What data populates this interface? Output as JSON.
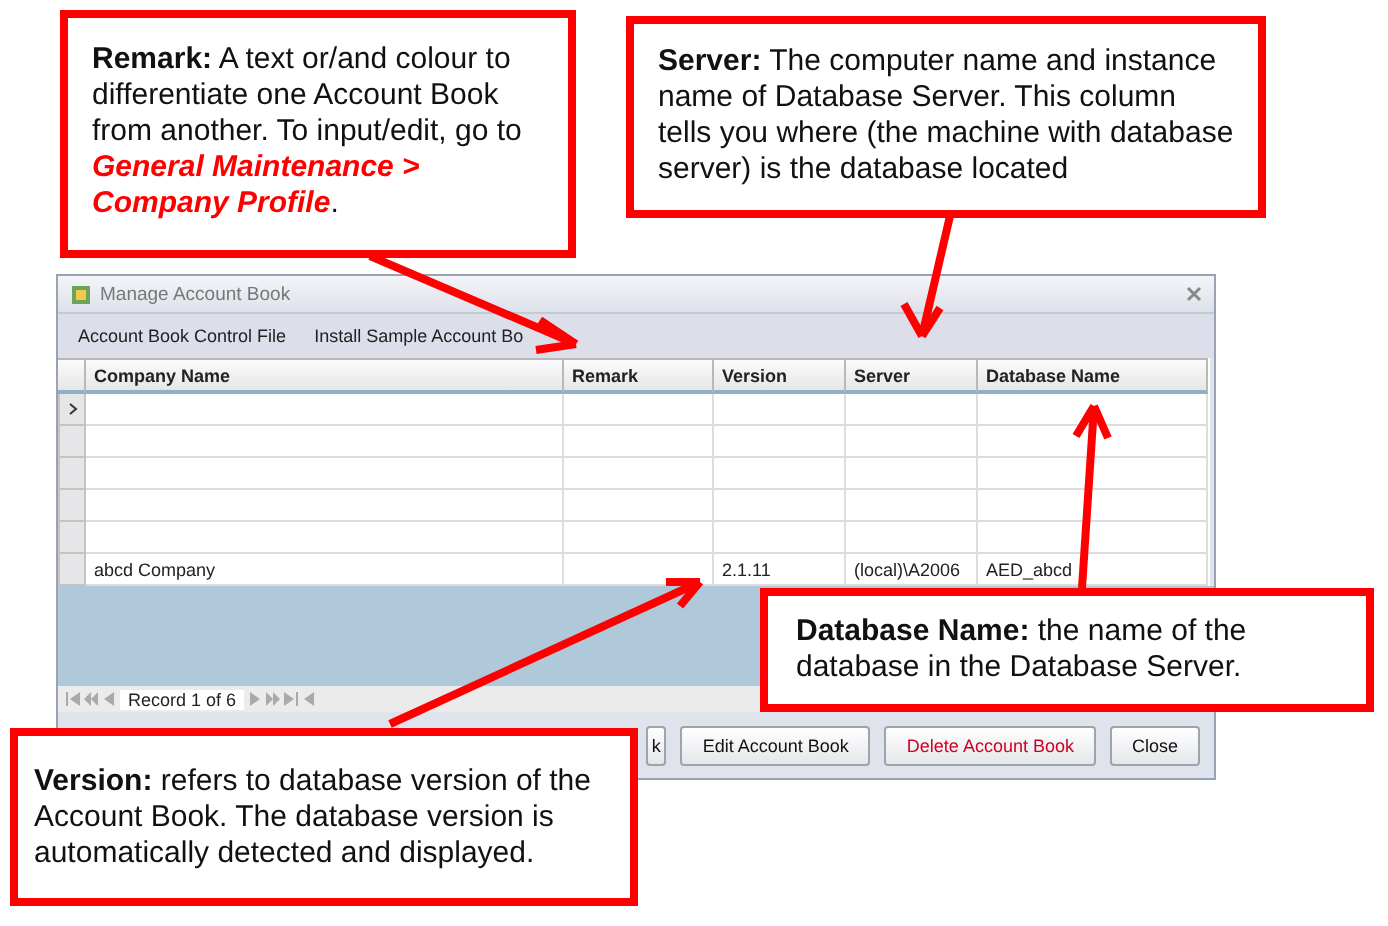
{
  "window": {
    "title": "Manage Account Book"
  },
  "menu": [
    "Account Book Control File",
    "Install Sample Account Bo"
  ],
  "table": {
    "columns": [
      "Company Name",
      "Remark",
      "Version",
      "Server",
      "Database Name"
    ],
    "rows": [
      {
        "selected": true,
        "cells": []
      },
      {
        "selected": false,
        "cells": []
      },
      {
        "selected": false,
        "cells": []
      },
      {
        "selected": false,
        "cells": []
      },
      {
        "selected": false,
        "cells": []
      },
      {
        "selected": false,
        "cells": [
          "abcd Company",
          "",
          "2.1.11",
          "(local)\\A2006",
          "AED_abcd"
        ]
      }
    ]
  },
  "navigator": {
    "record": "Record 1 of 6"
  },
  "buttons": [
    {
      "label": "k",
      "kind": "normal"
    },
    {
      "label": "Edit Account Book",
      "kind": "normal"
    },
    {
      "label": "Delete Account Book",
      "kind": "danger"
    },
    {
      "label": "Close",
      "kind": "normal"
    }
  ],
  "callouts": [
    {
      "text": "**Remark:** A text or/and colour to differentiate one Account Book from another. To input/edit, go to ",
      "highlight": "General Maintenance > Company Profile",
      "after": "."
    },
    {
      "text": "**Server:** The computer name and instance name of Database Server. This column tells you where (the machine with database server) is the database located"
    },
    {
      "text": "**Database Name:** the name of the database in the Database Server."
    },
    {
      "text": "**Version:** refers to database version of the Account Book. The database version is automatically detected and displayed."
    }
  ]
}
